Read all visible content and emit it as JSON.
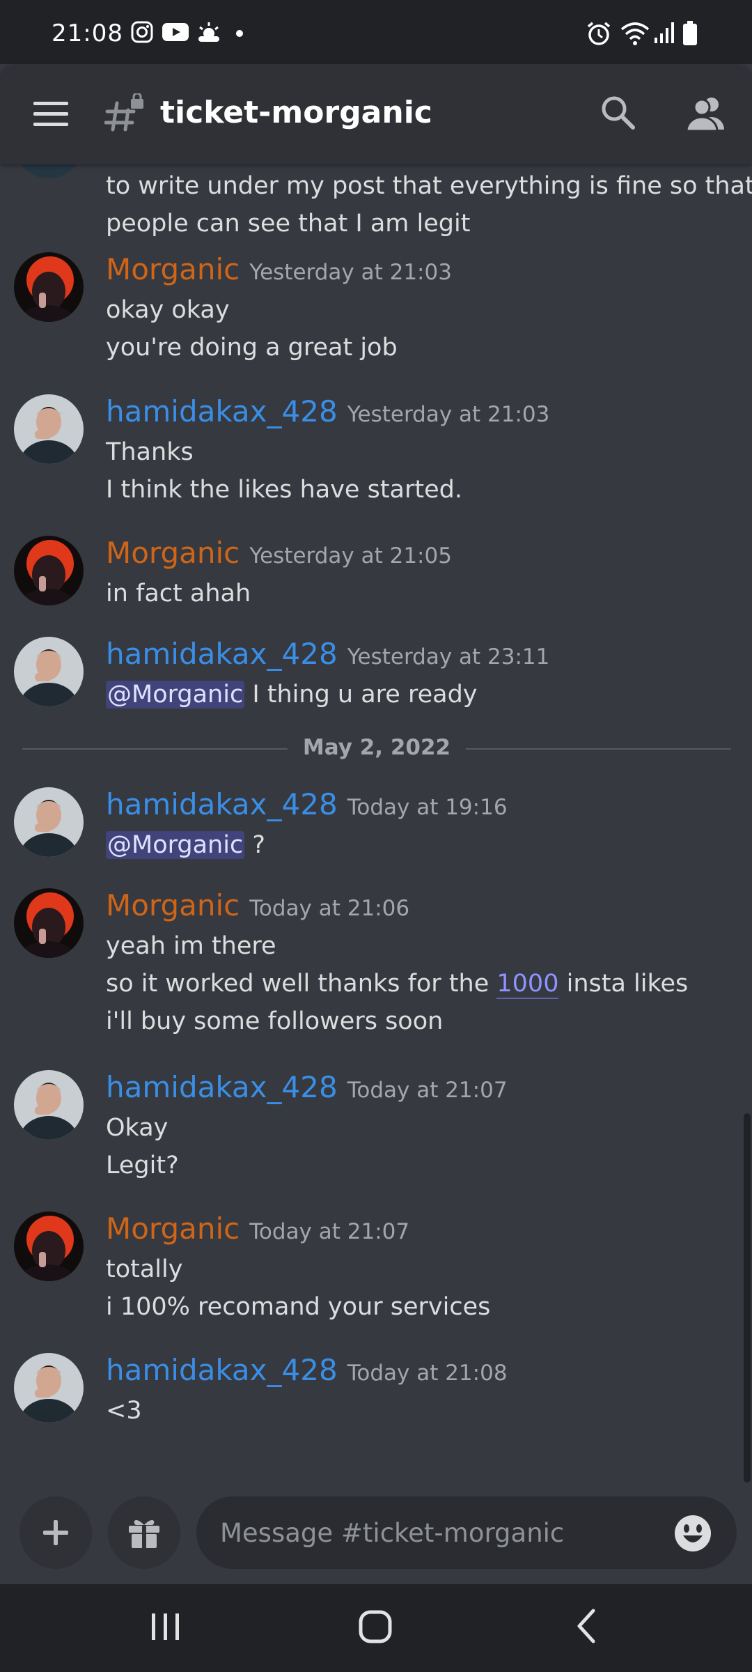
{
  "status_bar": {
    "time": "21:08",
    "icons": [
      "instagram-icon",
      "youtube-icon",
      "weather-icon",
      "dot-icon",
      "alarm-icon",
      "wifi-icon",
      "signal-icon",
      "battery-icon"
    ]
  },
  "header": {
    "channel_name": "ticket-morganic",
    "icons": [
      "hamburger-icon",
      "locked-channel-icon",
      "search-icon",
      "members-icon"
    ]
  },
  "colors": {
    "background": "#36393f",
    "header": "#2f3136",
    "morganic": "#cf6518",
    "hamid": "#3a8ee6",
    "mention_bg": "#41447a"
  },
  "messages": [
    {
      "author": "",
      "timestamp": "",
      "lines": [
        "to write under my post that everything is fine so that",
        "people can see that I am legit"
      ]
    },
    {
      "author": "Morganic",
      "timestamp": "Yesterday at 21:03",
      "lines": [
        "okay okay",
        "you're doing a great job"
      ]
    },
    {
      "author": "hamidakax_428",
      "timestamp": "Yesterday at 21:03",
      "lines": [
        "Thanks",
        "I think the likes have started."
      ]
    },
    {
      "author": "Morganic",
      "timestamp": "Yesterday at 21:05",
      "lines": [
        "in fact ahah"
      ]
    },
    {
      "author": "hamidakax_428",
      "timestamp": "Yesterday at 23:11",
      "mention": "@Morganic",
      "text_after": " I thing u are ready"
    },
    {
      "author": "hamidakax_428",
      "timestamp": "Today at 19:16",
      "mention": "@Morganic",
      "text_after": " ?"
    },
    {
      "author": "Morganic",
      "timestamp": "Today at 21:06",
      "lines": [
        "yeah im there",
        "so it worked well thanks for the ",
        "insta likes",
        "i'll buy some followers soon"
      ],
      "link": "1000"
    },
    {
      "author": "hamidakax_428",
      "timestamp": "Today at 21:07",
      "lines": [
        "Okay",
        "Legit?"
      ]
    },
    {
      "author": "Morganic",
      "timestamp": "Today at 21:07",
      "lines": [
        "totally",
        "i 100% recomand your services"
      ]
    },
    {
      "author": "hamidakax_428",
      "timestamp": "Today at 21:08",
      "lines": [
        "<3"
      ]
    }
  ],
  "date_divider": "May 2, 2022",
  "composer": {
    "placeholder": "Message #ticket-morganic",
    "icons": [
      "plus-icon",
      "gift-icon",
      "emoji-icon"
    ]
  },
  "nav_bar": {
    "icons": [
      "recents-icon",
      "home-icon",
      "back-icon"
    ]
  }
}
